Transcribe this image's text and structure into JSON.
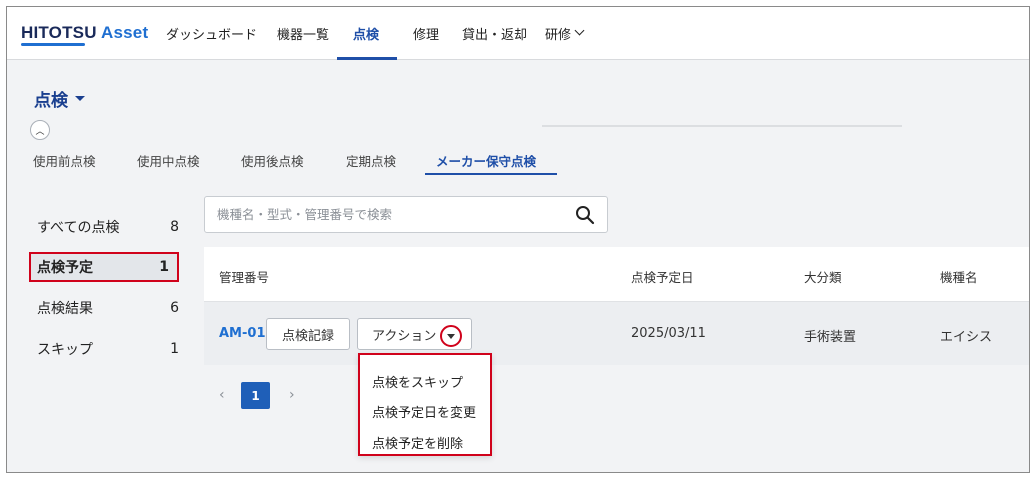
{
  "header": {
    "logo_main": "HITOTSU ",
    "logo_accent": "Asset",
    "nav": [
      {
        "label": "ダッシュボード"
      },
      {
        "label": "機器一覧"
      },
      {
        "label": "点検"
      },
      {
        "label": "修理"
      },
      {
        "label": "貸出・返却"
      },
      {
        "label": "研修"
      }
    ]
  },
  "page": {
    "title": "点検"
  },
  "tabs": [
    "使用前点検",
    "使用中点検",
    "使用後点検",
    "定期点検",
    "メーカー保守点検"
  ],
  "sidebar": {
    "items": [
      {
        "label": "すべての点検",
        "count": "8"
      },
      {
        "label": "点検予定",
        "count": "1"
      },
      {
        "label": "点検結果",
        "count": "6"
      },
      {
        "label": "スキップ",
        "count": "1"
      }
    ]
  },
  "search": {
    "placeholder": "機種名・型式・管理番号で検索"
  },
  "table": {
    "headers": [
      "管理番号",
      "点検予定日",
      "大分類",
      "機種名"
    ],
    "rows": [
      {
        "id": "AM-01",
        "record_button": "点検記録",
        "action_button": "アクション",
        "date": "2025/03/11",
        "category": "手術装置",
        "model": "エイシス"
      }
    ]
  },
  "pagination": {
    "current": "1",
    "prev": "‹",
    "next": "›"
  },
  "action_menu": {
    "items": [
      "点検をスキップ",
      "点検予定日を変更",
      "点検予定を削除"
    ]
  },
  "colors": {
    "brand": "#1f4fa8",
    "link": "#1f6fd1",
    "highlight": "#d0021b"
  }
}
